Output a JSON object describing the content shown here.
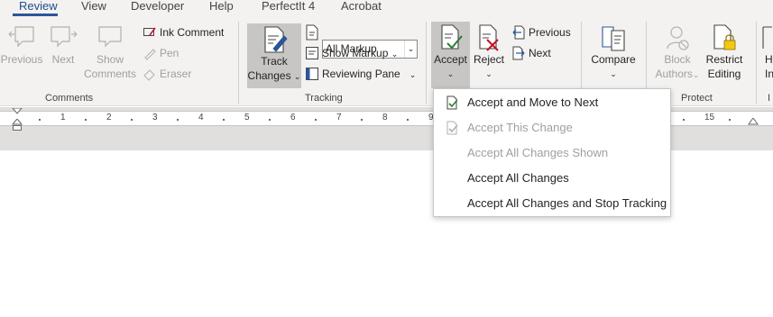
{
  "tabs": [
    {
      "label": "Review",
      "active": true
    },
    {
      "label": "View"
    },
    {
      "label": "Developer"
    },
    {
      "label": "Help"
    },
    {
      "label": "PerfectIt 4"
    },
    {
      "label": "Acrobat"
    }
  ],
  "ribbon": {
    "comments": {
      "previous": "Previous",
      "next": "Next",
      "show_comments_line1": "Show",
      "show_comments_line2": "Comments",
      "ink_comment": "Ink Comment",
      "pen": "Pen",
      "eraser": "Eraser",
      "group_label": "Comments"
    },
    "tracking": {
      "track_changes_line1": "Track",
      "track_changes_line2": "Changes",
      "display_for_review": "All Markup",
      "show_markup": "Show Markup",
      "reviewing_pane": "Reviewing Pane",
      "group_label": "Tracking"
    },
    "changes": {
      "accept": "Accept",
      "reject": "Reject",
      "previous": "Previous",
      "next": "Next"
    },
    "compare": {
      "compare": "Compare"
    },
    "protect": {
      "block_authors_line1": "Block",
      "block_authors_line2": "Authors",
      "restrict_editing_line1": "Restrict",
      "restrict_editing_line2": "Editing",
      "group_label": "Protect"
    },
    "ink": {
      "hide_ink_line1": "H",
      "hide_ink_line2": "In"
    },
    "cut_off_label": "I"
  },
  "ruler": {
    "numbers": [
      "1",
      "2",
      "3",
      "4",
      "5",
      "6",
      "7",
      "8",
      "9",
      "15"
    ]
  },
  "accept_menu": {
    "items": [
      {
        "label": "Accept and Move to Next",
        "enabled": true
      },
      {
        "label": "Accept This Change",
        "enabled": false
      },
      {
        "label": "Accept All Changes Shown",
        "enabled": false
      },
      {
        "label": "Accept All Changes",
        "enabled": true
      },
      {
        "label": "Accept All Changes and Stop Tracking",
        "enabled": true
      }
    ]
  },
  "colors": {
    "accent": "#2b579a",
    "pressed": "#c8c6c4",
    "disabled_text": "#a19f9d",
    "reject_red": "#c50f1f",
    "accept_green": "#2e7d32"
  }
}
